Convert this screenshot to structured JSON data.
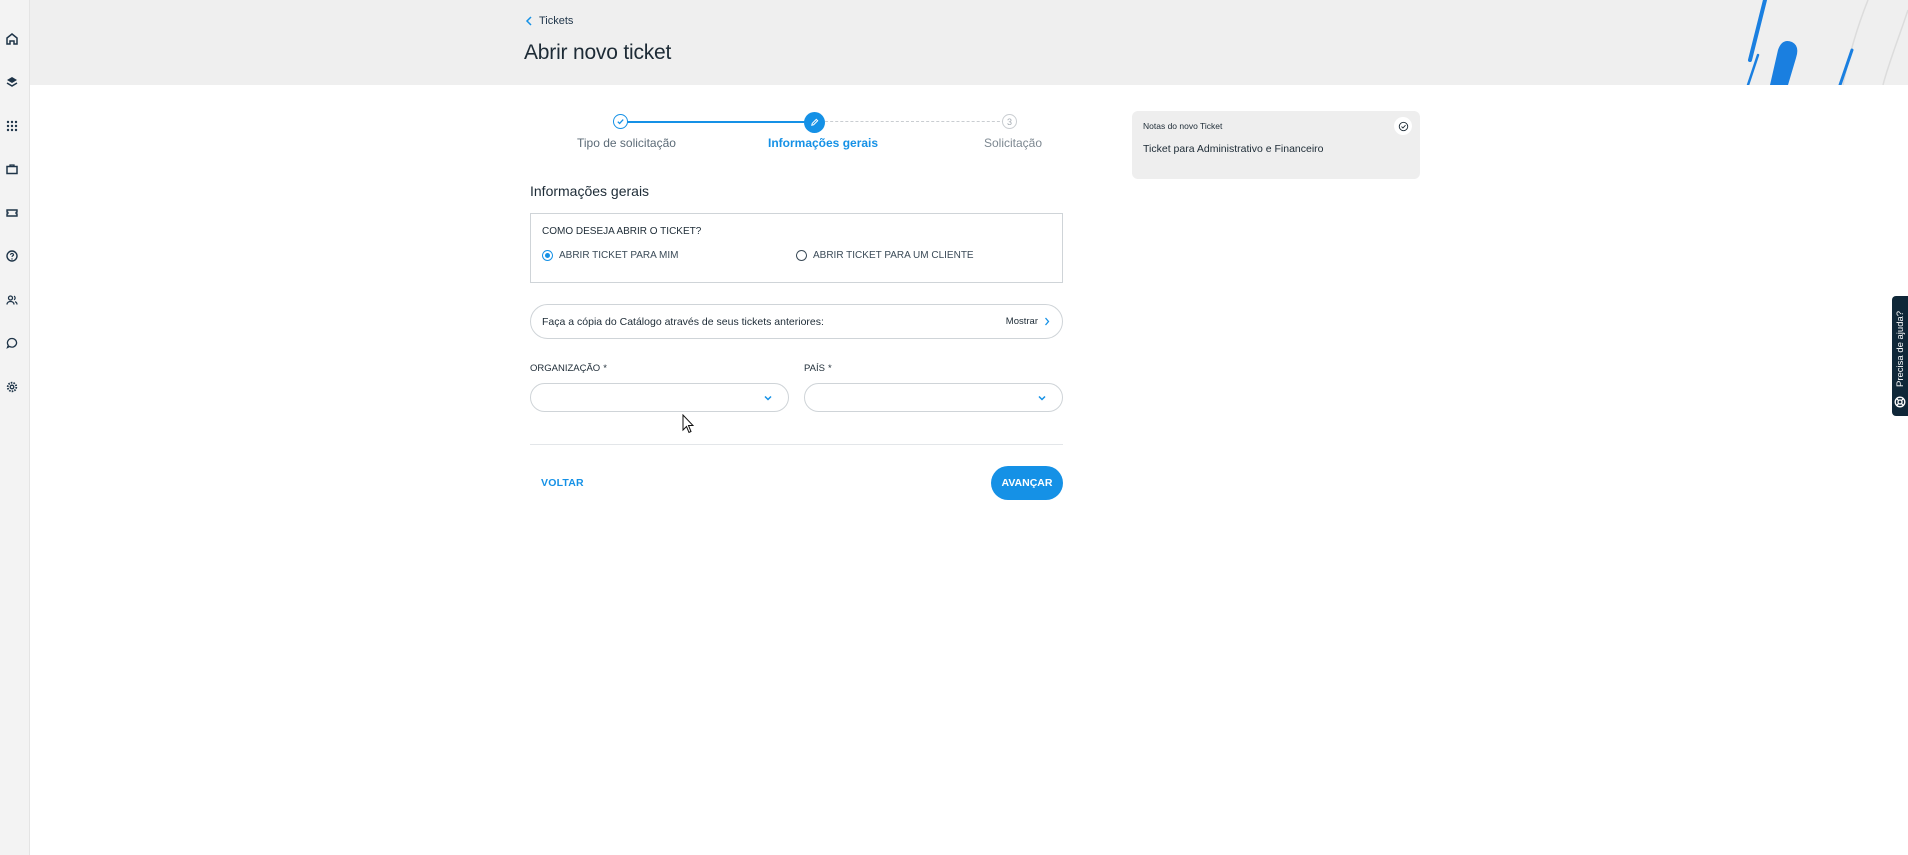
{
  "sidebar": {
    "icons": [
      "home-icon",
      "layers-icon",
      "grid-icon",
      "briefcase-icon",
      "ticket-icon",
      "help-icon",
      "users-icon",
      "chat-icon",
      "settings-icon"
    ]
  },
  "header": {
    "breadcrumb": "Tickets",
    "title": "Abrir novo ticket"
  },
  "stepper": {
    "steps": [
      {
        "label": "Tipo de solicitação",
        "state": "done"
      },
      {
        "label": "Informações gerais",
        "state": "active"
      },
      {
        "label": "Solicitação",
        "state": "todo",
        "number": "3"
      }
    ]
  },
  "form": {
    "section_title": "Informações gerais",
    "radio_question": "COMO DESEJA ABRIR O TICKET?",
    "radio_options": [
      {
        "label": "ABRIR TICKET PARA MIM",
        "checked": true
      },
      {
        "label": "ABRIR TICKET PARA UM CLIENTE",
        "checked": false
      }
    ],
    "copy_text": "Faça a cópia do Catálogo através de seus tickets anteriores:",
    "copy_action": "Mostrar",
    "org_label": "ORGANIZAÇÃO",
    "org_value": "",
    "country_label": "PAÍS",
    "country_value": "",
    "required_mark": "*",
    "back_label": "VOLTAR",
    "next_label": "AVANÇAR"
  },
  "notes": {
    "title": "Notas do novo Ticket",
    "body": "Ticket para Administrativo e Financeiro"
  },
  "help": {
    "label": "Precisa de ajuda?"
  },
  "colors": {
    "accent": "#1591e6",
    "dark": "#0f2738",
    "header_bg": "#efefef"
  }
}
